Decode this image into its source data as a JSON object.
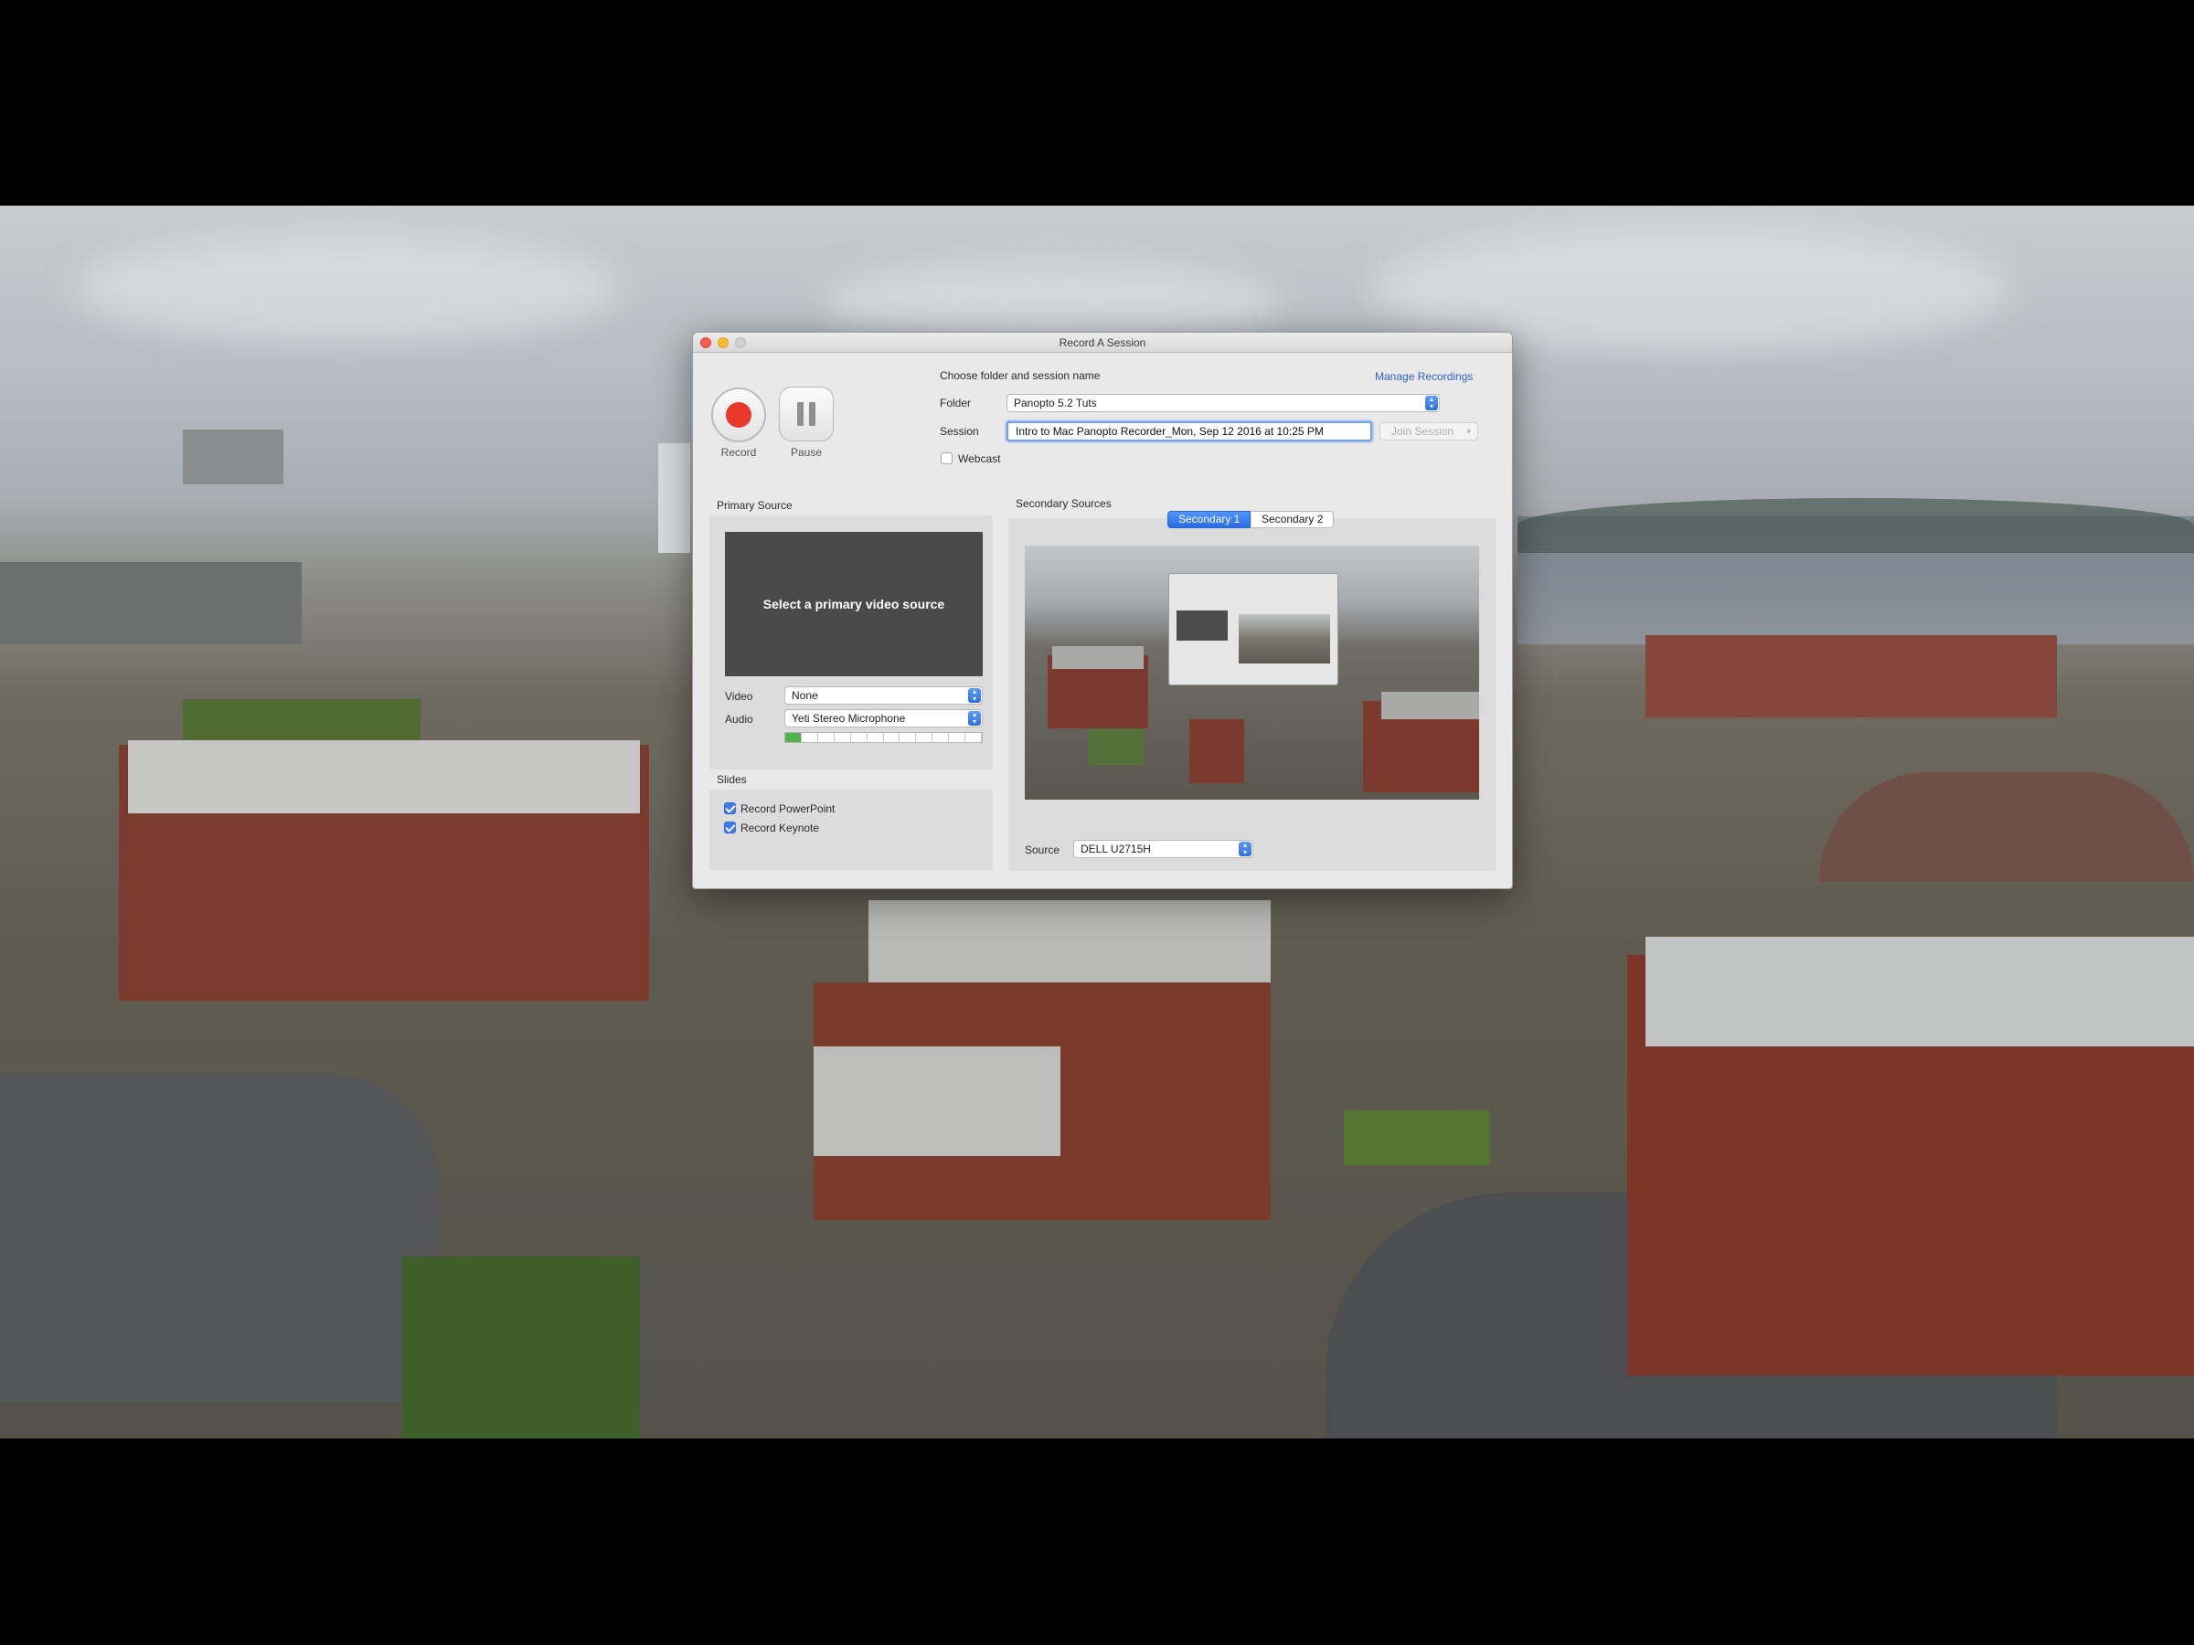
{
  "window": {
    "title": "Record A Session"
  },
  "controls": {
    "record_label": "Record",
    "pause_label": "Pause"
  },
  "session_setup": {
    "heading": "Choose folder and session name",
    "manage_recordings_link": "Manage Recordings",
    "folder_label": "Folder",
    "folder_value": "Panopto 5.2 Tuts",
    "session_label": "Session",
    "session_value": "Intro to Mac Panopto Recorder_Mon, Sep 12 2016 at 10:25 PM",
    "join_session_button": "Join Session",
    "webcast_label": "Webcast",
    "webcast_checked": false
  },
  "primary_source": {
    "heading": "Primary Source",
    "preview_placeholder": "Select a primary video source",
    "video_label": "Video",
    "video_value": "None",
    "audio_label": "Audio",
    "audio_value": "Yeti Stereo Microphone",
    "audio_level_segments_on": 1,
    "audio_level_segments_total": 12
  },
  "slides": {
    "heading": "Slides",
    "record_powerpoint_label": "Record PowerPoint",
    "record_powerpoint_checked": true,
    "record_keynote_label": "Record Keynote",
    "record_keynote_checked": true
  },
  "secondary_sources": {
    "heading": "Secondary Sources",
    "tabs": [
      {
        "label": "Secondary 1",
        "active": true
      },
      {
        "label": "Secondary 2",
        "active": false
      }
    ],
    "source_label": "Source",
    "source_value": "DELL U2715H"
  },
  "colors": {
    "record_red": "#e8372b",
    "accent_blue": "#2b6de0",
    "link_blue": "#2f5fd3",
    "level_green": "#53b24a"
  }
}
